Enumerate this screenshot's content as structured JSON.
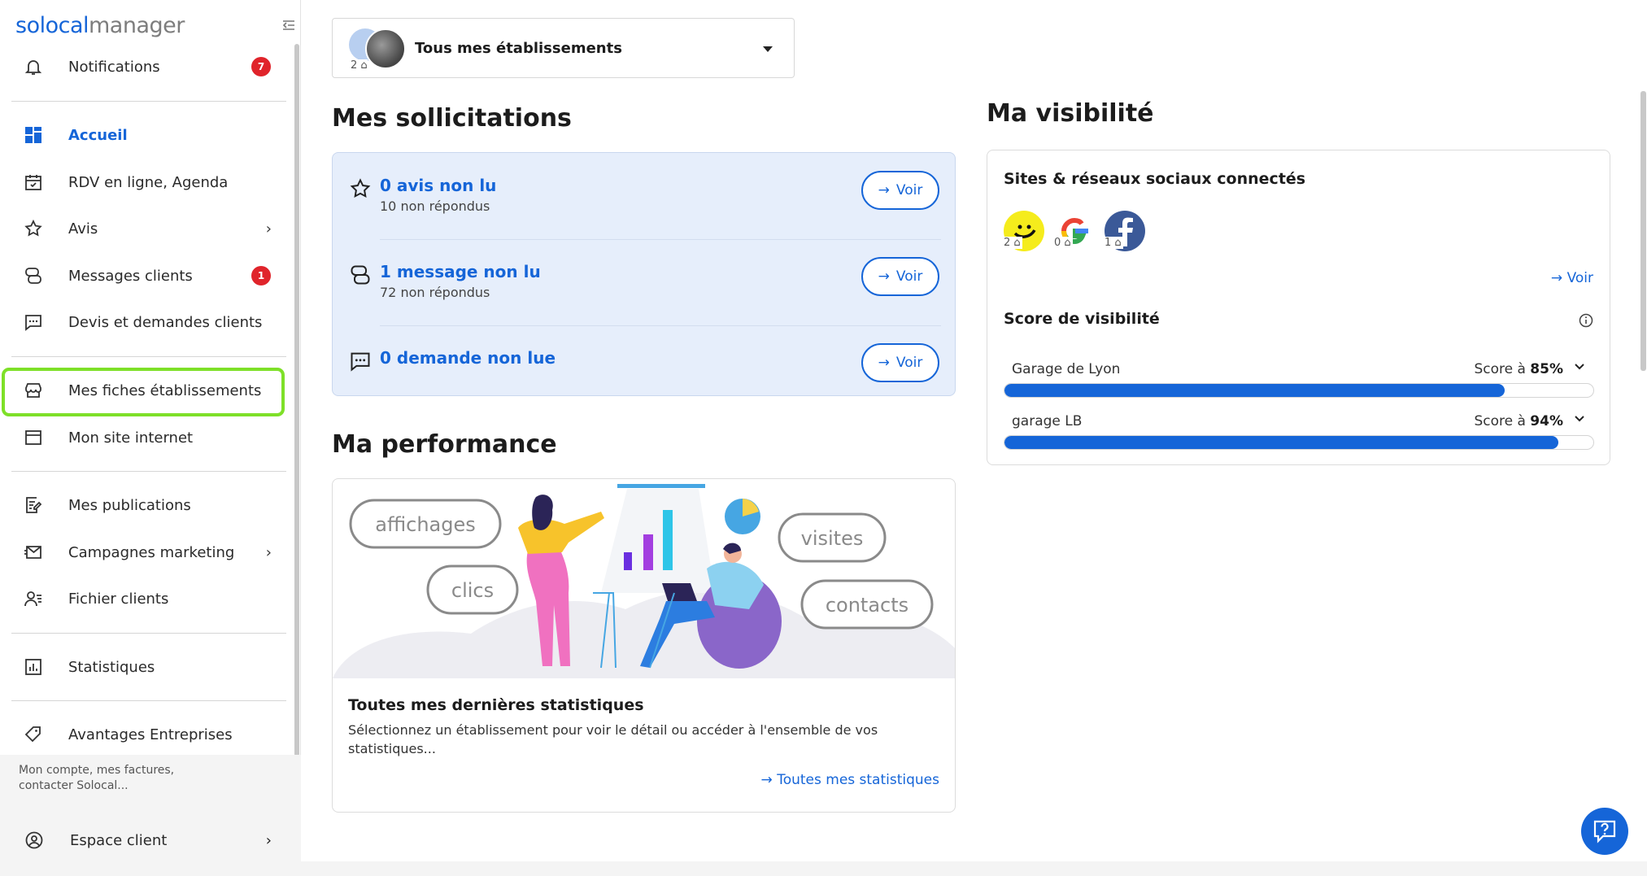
{
  "sidebar": {
    "logo": {
      "part1": "solocal",
      "part2": "manager"
    },
    "items": [
      {
        "label": "Notifications",
        "badge": "7"
      },
      {
        "label": "Accueil"
      },
      {
        "label": "RDV en ligne, Agenda"
      },
      {
        "label": "Avis"
      },
      {
        "label": "Messages clients",
        "badge": "1"
      },
      {
        "label": "Devis et demandes clients"
      },
      {
        "label": "Mes fiches établissements"
      },
      {
        "label": "Mon site internet"
      },
      {
        "label": "Mes publications"
      },
      {
        "label": "Campagnes marketing"
      },
      {
        "label": "Fichier clients"
      },
      {
        "label": "Statistiques"
      },
      {
        "label": "Avantages Entreprises"
      }
    ],
    "footer": {
      "text": "Mon compte, mes factures, contacter Solocal...",
      "espace_label": "Espace client"
    }
  },
  "selector": {
    "label": "Tous mes établissements",
    "count": "2"
  },
  "sollicitations": {
    "title": "Mes sollicitations",
    "rows": [
      {
        "title": "0 avis non lu",
        "sub": "10 non répondus",
        "button": "Voir"
      },
      {
        "title": "1 message non lu",
        "sub": "72 non répondus",
        "button": "Voir"
      },
      {
        "title": "0 demande non lue",
        "sub": "",
        "button": "Voir"
      }
    ]
  },
  "performance": {
    "title": "Ma performance",
    "bubbles": [
      "affichages",
      "clics",
      "visites",
      "contacts"
    ],
    "card_title": "Toutes mes dernières statistiques",
    "card_desc": "Sélectionnez un établissement pour voir le détail ou accéder à l'ensemble de vos statistiques...",
    "link": "Toutes mes statistiques"
  },
  "visibilite": {
    "title": "Ma visibilité",
    "networks_title": "Sites & réseaux sociaux connectés",
    "networks": [
      {
        "icon": "pagesjaunes-icon",
        "count": "2"
      },
      {
        "icon": "google-icon",
        "count": "0"
      },
      {
        "icon": "facebook-icon",
        "count": "1"
      }
    ],
    "voir": "Voir",
    "score_title": "Score de visibilité",
    "scores": [
      {
        "name": "Garage de Lyon",
        "prefix": "Score à",
        "value": "85%",
        "fraction": 0.85
      },
      {
        "name": "garage LB",
        "prefix": "Score à",
        "value": "94%",
        "fraction": 0.94
      }
    ]
  },
  "colors": {
    "accent": "#1565d8",
    "badge": "#e0242b",
    "highlight": "#7ee028"
  }
}
